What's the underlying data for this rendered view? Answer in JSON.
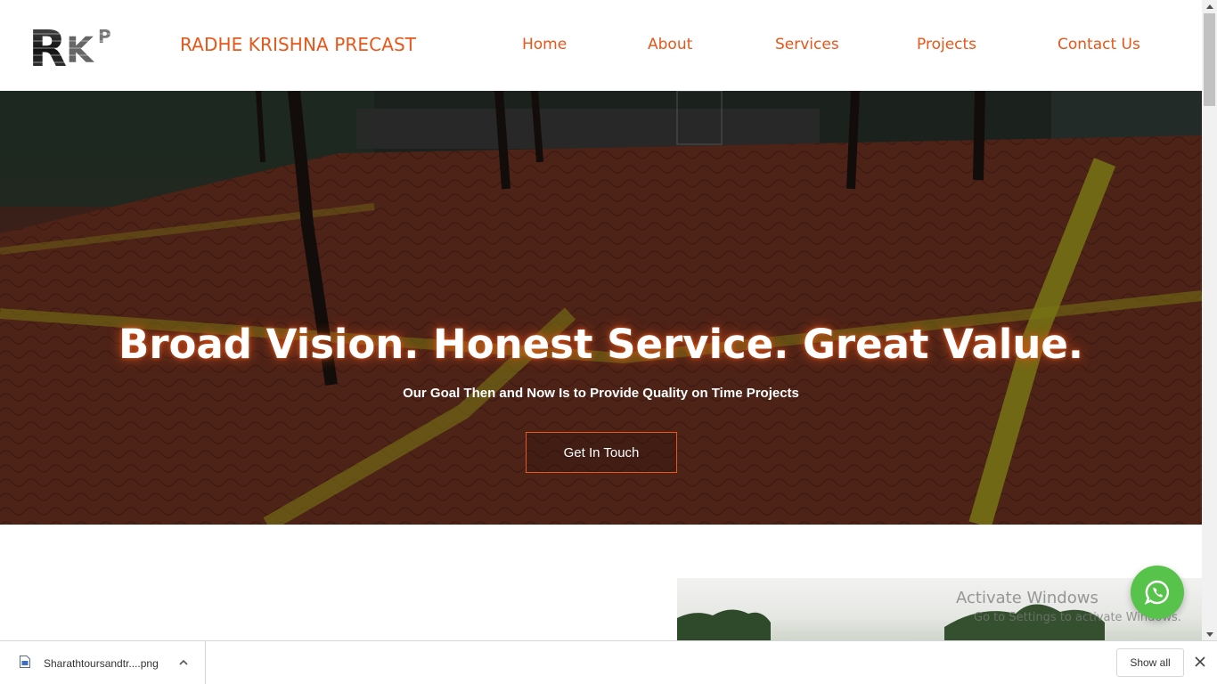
{
  "header": {
    "brand_name": "RADHE KRISHNA PRECAST",
    "logo_text": "RKP",
    "nav": [
      {
        "label": "Home"
      },
      {
        "label": "About"
      },
      {
        "label": "Services"
      },
      {
        "label": "Projects"
      },
      {
        "label": "Contact Us"
      }
    ]
  },
  "hero": {
    "title": "Broad Vision. Honest Service. Great Value.",
    "subtitle": "Our Goal Then and Now Is to Provide Quality on Time Projects",
    "cta_label": "Get In Touch"
  },
  "watermark": {
    "title": "Activate Windows",
    "subtitle": "Go to Settings to activate Windows."
  },
  "whatsapp": {
    "icon": "whatsapp-icon"
  },
  "download_bar": {
    "file_name": "Sharathtoursandtr....png",
    "show_all_label": "Show all"
  },
  "colors": {
    "accent": "#e8561a",
    "whatsapp_green": "#58c34a"
  }
}
